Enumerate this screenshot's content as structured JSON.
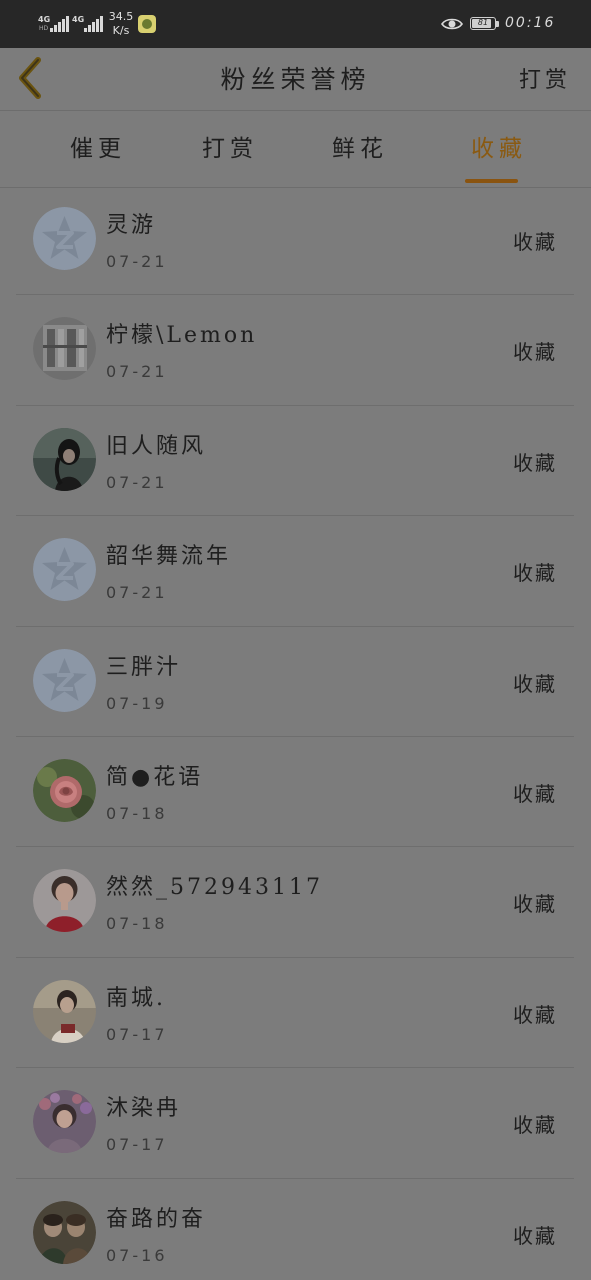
{
  "status_bar": {
    "sim1_type": "4G",
    "sim1_sub": "HD",
    "sim2_type": "4G",
    "speed_value": "34.5",
    "speed_unit": "K/s",
    "battery_level": "81",
    "time": "00:16",
    "icons": [
      "signal-icon",
      "app-notification-icon",
      "eye-comfort-icon",
      "battery-icon"
    ]
  },
  "nav": {
    "title": "粉丝荣誉榜",
    "action": "打赏",
    "back_icon": "chevron-left-icon",
    "accent_color": "#8a5410"
  },
  "tabs": [
    {
      "label": "催更",
      "active": false
    },
    {
      "label": "打赏",
      "active": false
    },
    {
      "label": "鲜花",
      "active": false
    },
    {
      "label": "收藏",
      "active": true
    }
  ],
  "fans": [
    {
      "name": "灵游",
      "date": "07-21",
      "action": "收藏",
      "avatar": "default-avatar-icon"
    },
    {
      "name": "柠檬\\Lemon",
      "date": "07-21",
      "action": "收藏",
      "avatar": "photo-avatar"
    },
    {
      "name": "旧人随风",
      "date": "07-21",
      "action": "收藏",
      "avatar": "photo-avatar"
    },
    {
      "name": "韶华舞流年",
      "date": "07-21",
      "action": "收藏",
      "avatar": "default-avatar-icon"
    },
    {
      "name": "三胖汁",
      "date": "07-19",
      "action": "收藏",
      "avatar": "default-avatar-icon"
    },
    {
      "name": "简●花语",
      "date": "07-18",
      "action": "收藏",
      "avatar": "photo-avatar"
    },
    {
      "name": "然然_572943117",
      "date": "07-18",
      "action": "收藏",
      "avatar": "photo-avatar"
    },
    {
      "name": "南城.",
      "date": "07-17",
      "action": "收藏",
      "avatar": "photo-avatar"
    },
    {
      "name": "沐染冉",
      "date": "07-17",
      "action": "收藏",
      "avatar": "photo-avatar"
    },
    {
      "name": "奋路的奋",
      "date": "07-16",
      "action": "收藏",
      "avatar": "photo-avatar"
    }
  ]
}
